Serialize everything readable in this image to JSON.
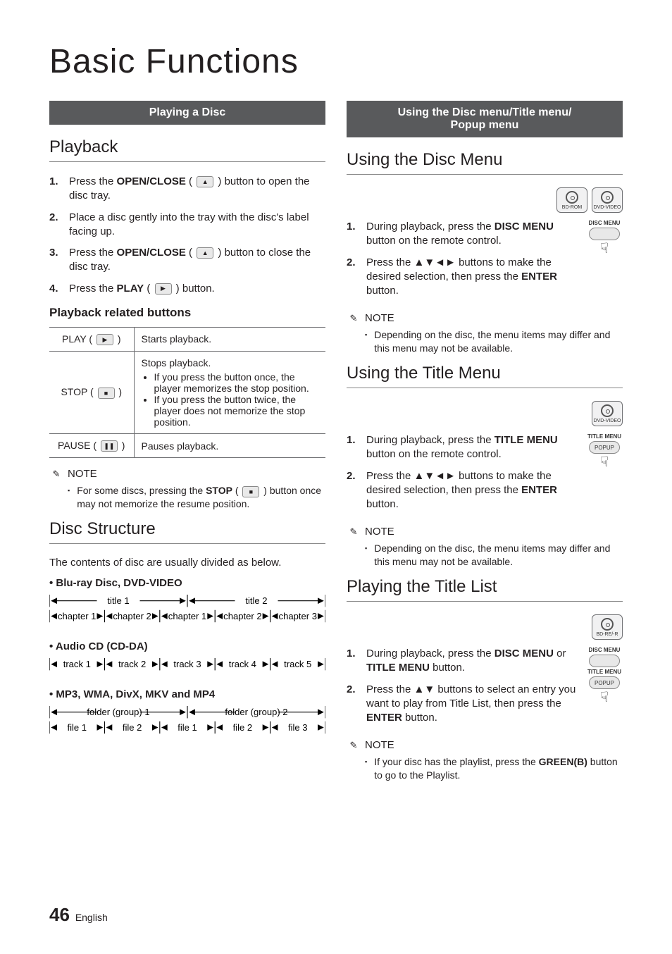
{
  "page_title": "Basic Functions",
  "footer": {
    "page": "46",
    "lang": "English"
  },
  "left": {
    "bar": "Playing a Disc",
    "h_playback": "Playback",
    "steps": [
      {
        "n": "1.",
        "pre": "Press the ",
        "bold": "OPEN/CLOSE",
        "post": " button to open the disc tray.",
        "icon": "▲"
      },
      {
        "n": "2.",
        "pre": "Place a disc gently into the tray with the disc's label facing up.",
        "bold": "",
        "post": "",
        "icon": ""
      },
      {
        "n": "3.",
        "pre": "Press the ",
        "bold": "OPEN/CLOSE",
        "post": " button to close the disc tray.",
        "icon": "▲"
      },
      {
        "n": "4.",
        "pre": "Press the ",
        "bold": "PLAY",
        "post": " button.",
        "icon": "▶"
      }
    ],
    "h_related": "Playback related buttons",
    "table": {
      "rows": [
        {
          "label": "PLAY",
          "icon": "▶",
          "desc": "Starts playback.",
          "bullets": []
        },
        {
          "label": "STOP",
          "icon": "■",
          "desc": "Stops playback.",
          "bullets": [
            "If you press the button once, the player memorizes the stop position.",
            "If you press the button twice, the player does not memorize the stop position."
          ]
        },
        {
          "label": "PAUSE",
          "icon": "❚❚",
          "desc": "Pauses playback.",
          "bullets": []
        }
      ]
    },
    "note_label": "NOTE",
    "note1_pre": "For some discs, pressing the ",
    "note1_bold": "STOP",
    "note1_post": " button once may not memorize the resume position.",
    "h_struct": "Disc Structure",
    "struct_intro": "The contents of disc are usually divided as below.",
    "struct": [
      {
        "head": "Blu-ray Disc, DVD-VIDEO",
        "row1": [
          "title 1",
          "title 2"
        ],
        "row2": [
          "chapter 1",
          "chapter 2",
          "chapter 1",
          "chapter 2",
          "chapter 3"
        ]
      },
      {
        "head": "Audio CD (CD-DA)",
        "row1": [],
        "row2": [
          "track 1",
          "track 2",
          "track 3",
          "track 4",
          "track 5"
        ]
      },
      {
        "head": "MP3, WMA, DivX, MKV and MP4",
        "row1": [
          "folder (group) 1",
          "folder (group) 2"
        ],
        "row2": [
          "file 1",
          "file 2",
          "file 1",
          "file 2",
          "file 3"
        ]
      }
    ]
  },
  "right": {
    "bar": "Using the Disc menu/Title menu/\nPopup menu",
    "sections": [
      {
        "title": "Using the Disc Menu",
        "badges": [
          "BD-ROM",
          "DVD-VIDEO"
        ],
        "remote": {
          "labels": [
            "DISC MENU"
          ],
          "keys": [
            ""
          ],
          "hand": true
        },
        "steps": [
          {
            "n": "1.",
            "t": "During playback, press the <b>DISC MENU</b> button on the remote control."
          },
          {
            "n": "2.",
            "t": "Press the ▲▼◄► buttons to make the desired selection, then press the <b>ENTER</b> button."
          }
        ],
        "note": "Depending on the disc, the menu items may differ and this menu may not be available."
      },
      {
        "title": "Using the Title Menu",
        "badges": [
          "DVD-VIDEO"
        ],
        "remote": {
          "labels": [
            "TITLE MENU"
          ],
          "keys": [
            "POPUP"
          ],
          "hand": true
        },
        "steps": [
          {
            "n": "1.",
            "t": "During playback, press the <b>TITLE MENU</b> button on the remote control."
          },
          {
            "n": "2.",
            "t": "Press the ▲▼◄► buttons to make the desired selection, then press the <b>ENTER</b> button."
          }
        ],
        "note": "Depending on the disc, the menu items may differ and this menu may not be available."
      },
      {
        "title": "Playing the Title List",
        "badges": [
          "BD-RE/-R"
        ],
        "remote": {
          "labels": [
            "DISC MENU",
            "TITLE MENU"
          ],
          "keys": [
            "",
            "POPUP"
          ],
          "hand": true
        },
        "steps": [
          {
            "n": "1.",
            "t": "During playback, press the <b>DISC MENU</b> or <b>TITLE MENU</b> button."
          },
          {
            "n": "2.",
            "t": "Press the ▲▼ buttons to select an entry you want to play from Title List, then press the <b>ENTER</b> button."
          }
        ],
        "note": "If your disc has the playlist, press the <b>GREEN(B)</b> button to go to the Playlist."
      }
    ],
    "note_label": "NOTE"
  }
}
